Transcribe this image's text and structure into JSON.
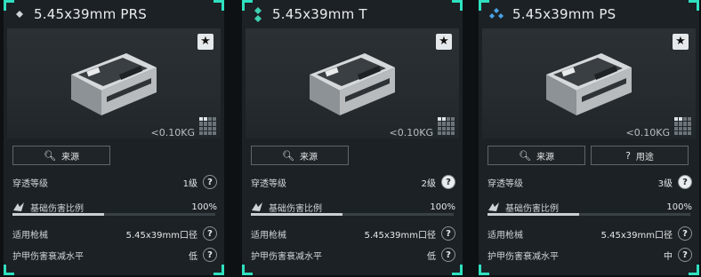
{
  "cards": [
    {
      "title": "5.45x39mm PRS",
      "rarity_icon": "diamond-small-icon",
      "weight": "<0.10KG",
      "buttons": [
        {
          "label": "来源",
          "icon": "search-icon"
        }
      ],
      "rows": {
        "penetration_label": "穿透等级",
        "penetration_value": "1级",
        "damage_label": "基础伤害比例",
        "damage_value": "100%",
        "damage_fraction": 0.45,
        "weapon_label": "适用枪械",
        "weapon_value": "5.45x39mm口径",
        "armor_label": "护甲伤害衰减水平",
        "armor_value": "低"
      }
    },
    {
      "title": "5.45x39mm T",
      "rarity_icon": "double-diamond-icon",
      "weight": "<0.10KG",
      "buttons": [
        {
          "label": "来源",
          "icon": "search-icon"
        }
      ],
      "rows": {
        "penetration_label": "穿透等级",
        "penetration_value": "2级",
        "damage_label": "基础伤害比例",
        "damage_value": "100%",
        "damage_fraction": 0.45,
        "weapon_label": "适用枪械",
        "weapon_value": "5.45x39mm口径",
        "armor_label": "护甲伤害衰减水平",
        "armor_value": "低"
      }
    },
    {
      "title": "5.45x39mm PS",
      "rarity_icon": "triple-diamond-icon",
      "weight": "<0.10KG",
      "buttons": [
        {
          "label": "来源",
          "icon": "search-icon"
        },
        {
          "label": "用途",
          "icon": "question-icon"
        }
      ],
      "rows": {
        "penetration_label": "穿透等级",
        "penetration_value": "3级",
        "damage_label": "基础伤害比例",
        "damage_value": "100%",
        "damage_fraction": 0.45,
        "weapon_label": "适用枪械",
        "weapon_value": "5.45x39mm口径",
        "armor_label": "护甲伤害衰减水平",
        "armor_value": "中"
      }
    }
  ],
  "colors": {
    "accent": "#2fe0c0",
    "panel": "#1c2125",
    "rarity_t": "#3fd0b0",
    "rarity_ps": "#4aa3e8"
  }
}
